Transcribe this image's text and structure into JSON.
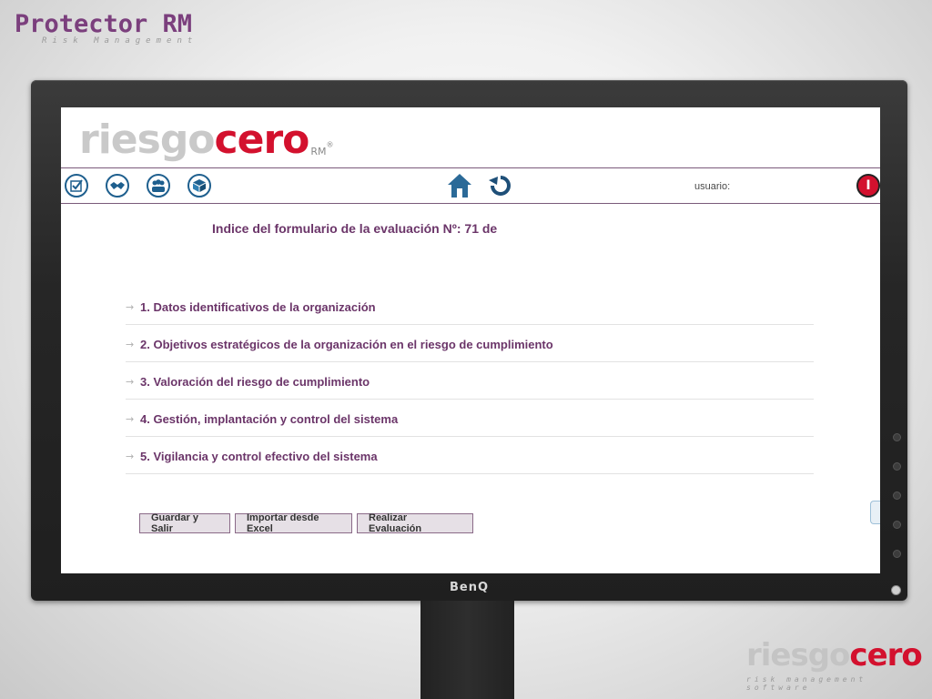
{
  "brand": {
    "title": "Protector RM",
    "subtitle": "Risk Management"
  },
  "monitor": {
    "brand_label": "BenQ"
  },
  "app": {
    "logo": {
      "part1": "riesgo",
      "part2": "cero",
      "rm": "RM",
      "reg": "®"
    },
    "toolbar": {
      "icons": [
        "checklist-icon",
        "handshake-icon",
        "users-icon",
        "box-icon",
        "home-icon",
        "refresh-icon"
      ],
      "user_label": "usuario:",
      "logout_glyph": "I"
    },
    "title": "Indice del formulario de la evaluación Nº: 71 de",
    "sections": [
      {
        "label": "1. Datos identificativos de la organización"
      },
      {
        "label": "2. Objetivos estratégicos de la organización en el riesgo de cumplimiento"
      },
      {
        "label": "3. Valoración del riesgo de cumplimiento"
      },
      {
        "label": "4. Gestión, implantación y control del sistema"
      },
      {
        "label": "5. Vigilancia y control efectivo del sistema"
      }
    ],
    "buttons": {
      "save_exit": "Guardar y Salir",
      "import_excel": "Importar desde Excel",
      "evaluate": "Realizar Evaluación"
    }
  },
  "footer_brand": {
    "part1": "riesgo",
    "part2": "cero",
    "subtitle": "risk management software"
  },
  "colors": {
    "accent": "#6b3569",
    "red": "#d3112e",
    "icon_blue": "#1e5f8e"
  }
}
